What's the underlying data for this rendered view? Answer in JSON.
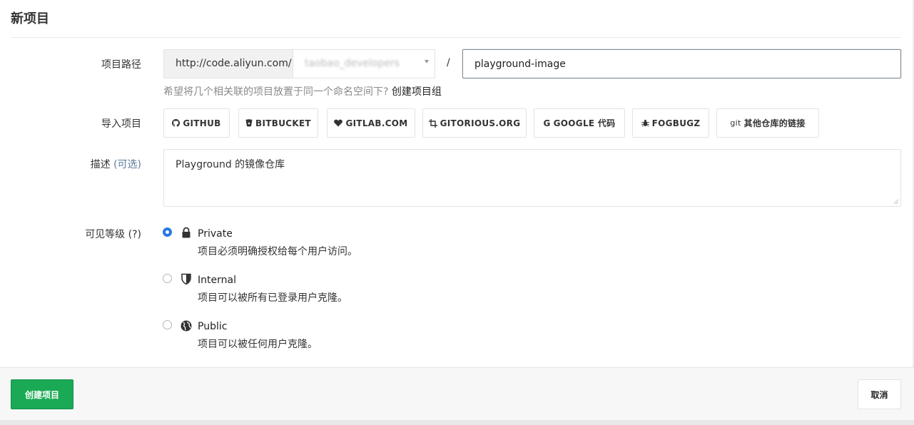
{
  "page": {
    "title": "新项目"
  },
  "path": {
    "label": "项目路径",
    "prefix": "http://code.aliyun.com/",
    "namespace": "taobao_developers",
    "separator": "/",
    "project_name": "playground-image",
    "help_text": "希望将几个相关联的项目放置于同一个命名空间下?",
    "help_link": "创建项目组"
  },
  "import": {
    "label": "导入项目",
    "buttons": [
      {
        "label": "GITHUB",
        "icon": "github-icon"
      },
      {
        "label": "BITBUCKET",
        "icon": "bitbucket-icon"
      },
      {
        "label": "GITLAB.COM",
        "icon": "heart-icon"
      },
      {
        "label": "GITORIOUS.ORG",
        "icon": "crop-icon"
      },
      {
        "label": "GOOGLE 代码",
        "icon": "google-icon"
      },
      {
        "label": "FOGBUGZ",
        "icon": "bug-icon"
      },
      {
        "label": "其他仓库的链接",
        "icon": "git-icon",
        "icon_text": "git"
      }
    ]
  },
  "description": {
    "label": "描述",
    "label_optional": "(可选)",
    "value": "Playground 的镜像仓库"
  },
  "visibility": {
    "label": "可见等级 (?)",
    "selected": "Private",
    "options": [
      {
        "title": "Private",
        "desc": "项目必须明确授权给每个用户访问。",
        "icon": "lock-icon"
      },
      {
        "title": "Internal",
        "desc": "项目可以被所有已登录用户克隆。",
        "icon": "shield-icon"
      },
      {
        "title": "Public",
        "desc": "项目可以被任何用户克隆。",
        "icon": "globe-icon"
      }
    ]
  },
  "footer": {
    "create_label": "创建项目",
    "cancel_label": "取消"
  },
  "colors": {
    "primary_green": "#1aaa55",
    "radio_blue": "#2a7ae2",
    "link_muted": "#5b7a9b"
  }
}
